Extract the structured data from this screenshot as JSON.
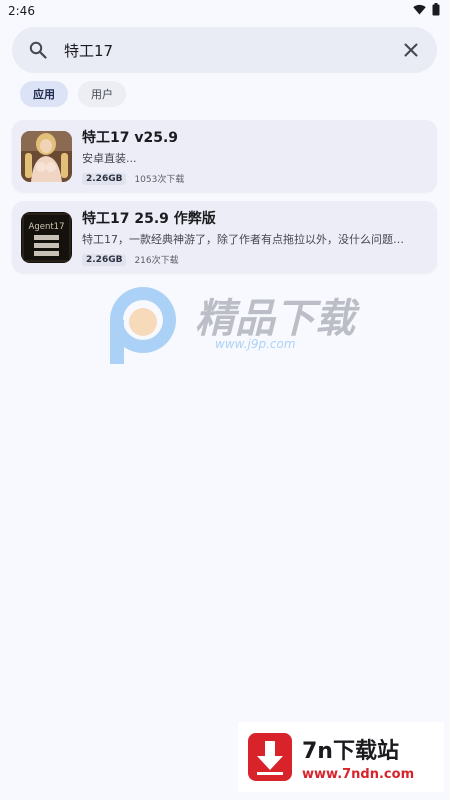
{
  "status_bar": {
    "time": "2:46",
    "wifi_icon": "wifi-icon",
    "battery_icon": "battery-icon"
  },
  "search": {
    "value": "特工17",
    "search_icon": "search-icon",
    "clear_icon": "close-icon"
  },
  "filters": [
    {
      "label": "应用",
      "active": true
    },
    {
      "label": "用户",
      "active": false
    }
  ],
  "results": [
    {
      "title": "特工17 v25.9",
      "description": "安卓直装...",
      "size": "2.26GB",
      "downloads": "1053次下载"
    },
    {
      "title": "特工17 25.9 作弊版",
      "description": "特工17，一款经典神游了，除了作者有点拖拉以外，没什么问题，我知道...",
      "size": "2.26GB",
      "downloads": "216次下载",
      "icon_text": "Agent17"
    }
  ],
  "watermark_center": {
    "name": "精品下载",
    "url": "www.j9p.com"
  },
  "watermark_corner": {
    "name": "7n下载站",
    "url": "www.7ndn.com"
  },
  "colors": {
    "background": "#f8f9fe",
    "card": "#ecedf6",
    "chip_active": "#dde3f7",
    "accent_red": "#d8232a"
  }
}
